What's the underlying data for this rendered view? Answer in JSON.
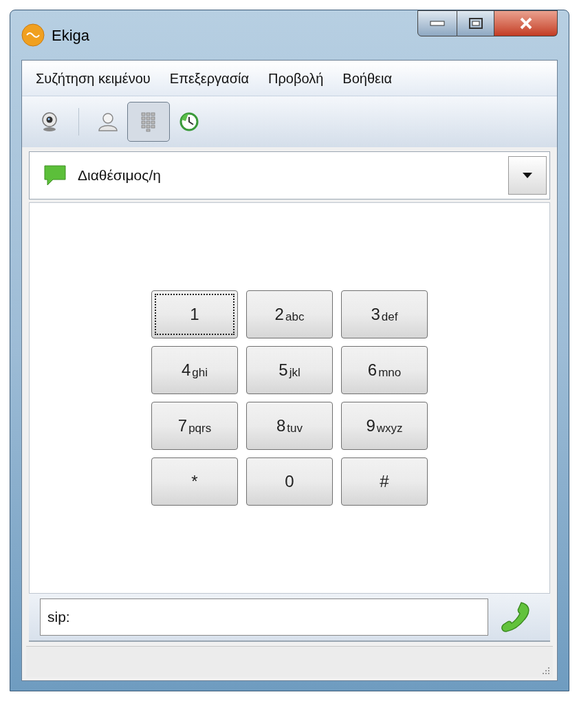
{
  "window": {
    "title": "Ekiga"
  },
  "menu": [
    "Συζήτηση κειμένου",
    "Επεξεργασία",
    "Προβολή",
    "Βοήθεια"
  ],
  "toolbar": [
    {
      "kind": "webcam",
      "selected": false
    },
    {
      "kind": "separator"
    },
    {
      "kind": "contacts",
      "selected": false
    },
    {
      "kind": "dialpad",
      "selected": true
    },
    {
      "kind": "history",
      "selected": false
    }
  ],
  "presence": {
    "value": "Διαθέσιμος/η"
  },
  "keypad": [
    {
      "digit": "1",
      "focused": true
    },
    {
      "digit": "2",
      "letters": "abc",
      "focused": false
    },
    {
      "digit": "3",
      "letters": "def",
      "focused": false
    },
    {
      "digit": "4",
      "letters": "ghi",
      "focused": false
    },
    {
      "digit": "5",
      "letters": "jkl",
      "focused": false
    },
    {
      "digit": "6",
      "letters": "mno",
      "focused": false
    },
    {
      "digit": "7",
      "letters": "pqrs",
      "focused": false
    },
    {
      "digit": "8",
      "letters": "tuv",
      "focused": false
    },
    {
      "digit": "9",
      "letters": "wxyz",
      "focused": false
    },
    {
      "digit": "*",
      "focused": false
    },
    {
      "digit": "0",
      "focused": false
    },
    {
      "digit": "#",
      "focused": false
    }
  ],
  "address": {
    "value": "sip:"
  }
}
